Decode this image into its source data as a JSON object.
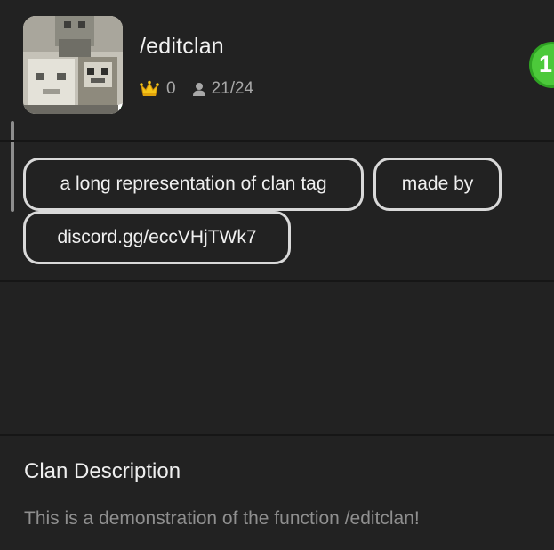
{
  "clan": {
    "name": "/editclan",
    "crowns": "0",
    "members": "21/24"
  },
  "notification": {
    "count": "1"
  },
  "tags": [
    "a long representation of clan tag",
    "made by",
    "discord.gg/eccVHjTWk7"
  ],
  "description": {
    "title": "Clan Description",
    "text": "This is a demonstration of the function /editclan!"
  },
  "colors": {
    "background": "#222222",
    "divider": "#161616",
    "tag_border": "#d9d9d9",
    "verified": "#2fb344",
    "crown": "#f5c518",
    "notification": "#4cc93a"
  }
}
